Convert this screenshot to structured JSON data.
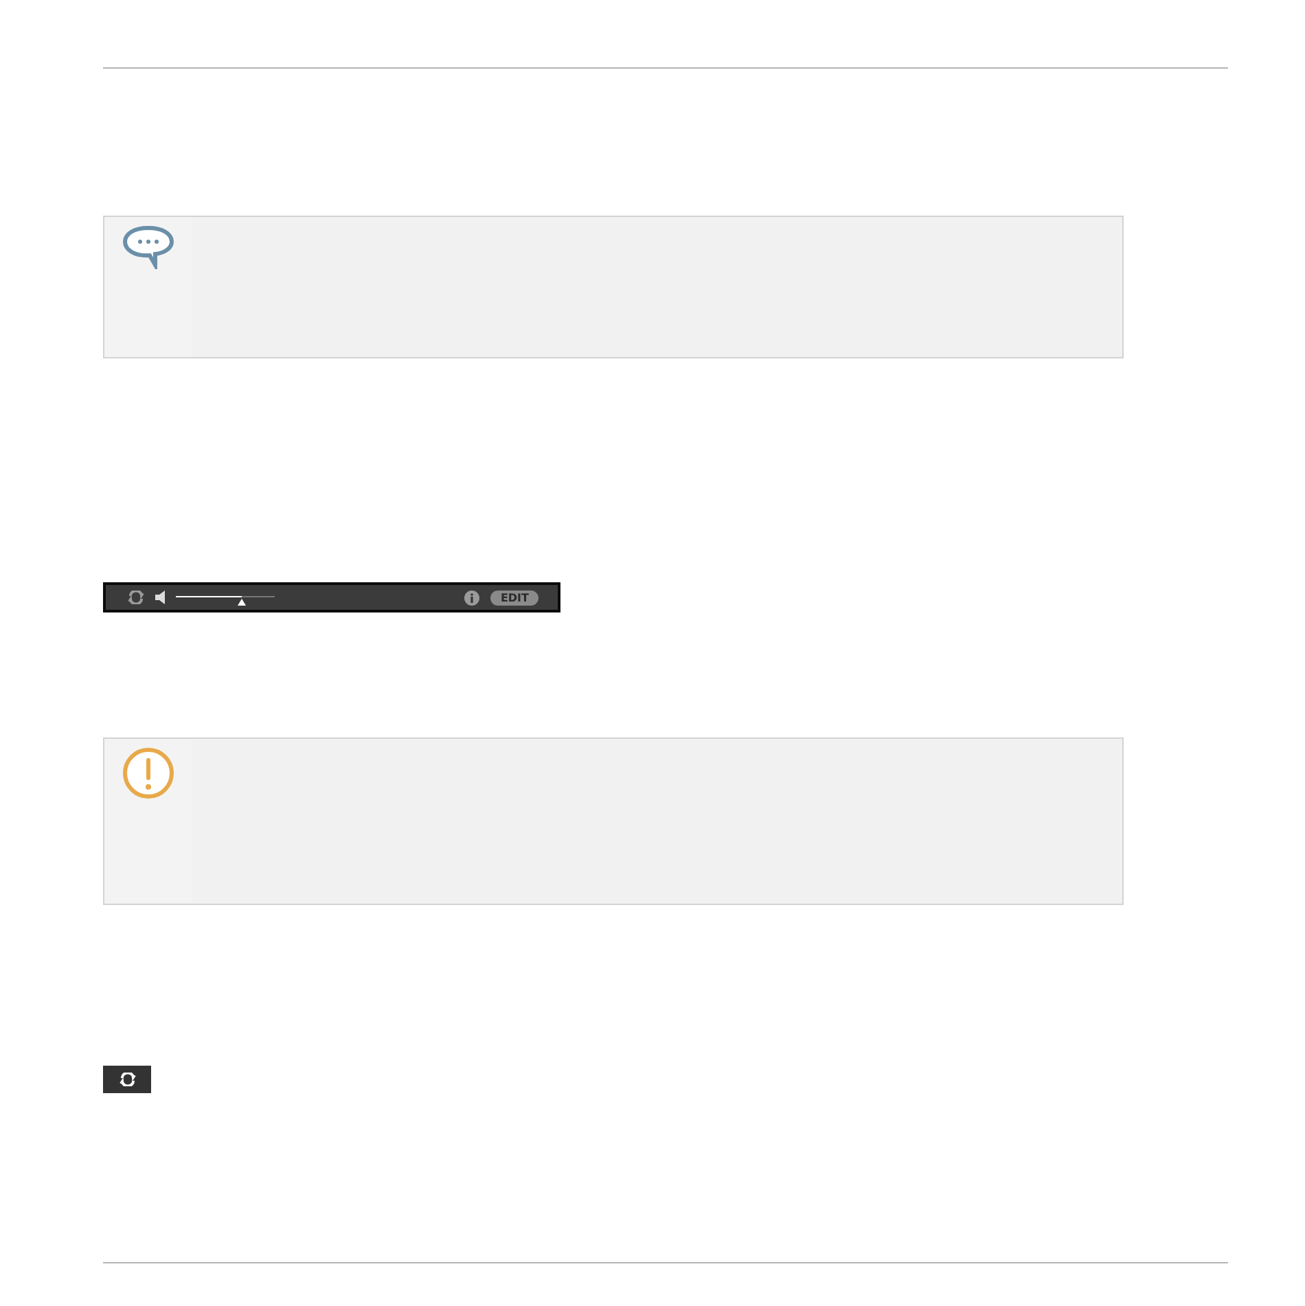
{
  "notes": [
    {
      "kind": "tip"
    },
    {
      "kind": "warning"
    }
  ],
  "toolbar": {
    "volume": {
      "level": 0.67
    },
    "edit_button": "EDIT"
  }
}
